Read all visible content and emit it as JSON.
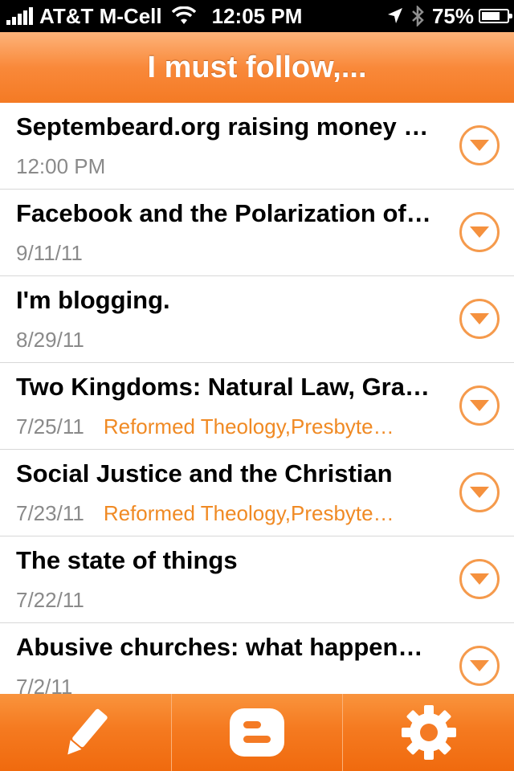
{
  "status_bar": {
    "carrier": "AT&T M-Cell",
    "time": "12:05 PM",
    "battery_percent": "75%",
    "battery_level": 0.75,
    "icons": [
      "signal-icon",
      "wifi-icon",
      "location-arrow-icon",
      "bluetooth-icon",
      "battery-icon"
    ]
  },
  "header": {
    "title": "I must follow,..."
  },
  "posts": [
    {
      "title": "Septembeard.org raising money for…",
      "date": "12:00 PM",
      "categories": ""
    },
    {
      "title": "Facebook and the Polarization of…",
      "date": "9/11/11",
      "categories": ""
    },
    {
      "title": "I'm blogging.",
      "date": "8/29/11",
      "categories": ""
    },
    {
      "title": "Two Kingdoms: Natural Law, Grace…",
      "date": "7/25/11",
      "categories": "Reformed Theology,Presbyterian…"
    },
    {
      "title": "Social Justice and the Christian",
      "date": "7/23/11",
      "categories": "Reformed Theology,Presbyterian…"
    },
    {
      "title": "The state of things",
      "date": "7/22/11",
      "categories": ""
    },
    {
      "title": "Abusive churches: what happens…",
      "date": "7/2/11",
      "categories": ""
    }
  ],
  "tab_bar": {
    "tabs": [
      {
        "name": "compose",
        "icon": "pencil-icon"
      },
      {
        "name": "blogger",
        "icon": "blogger-icon"
      },
      {
        "name": "settings",
        "icon": "gear-icon"
      }
    ]
  },
  "colors": {
    "accent": "#f47a24",
    "category_text": "#f08a24",
    "date_text": "#8a8a8a"
  }
}
